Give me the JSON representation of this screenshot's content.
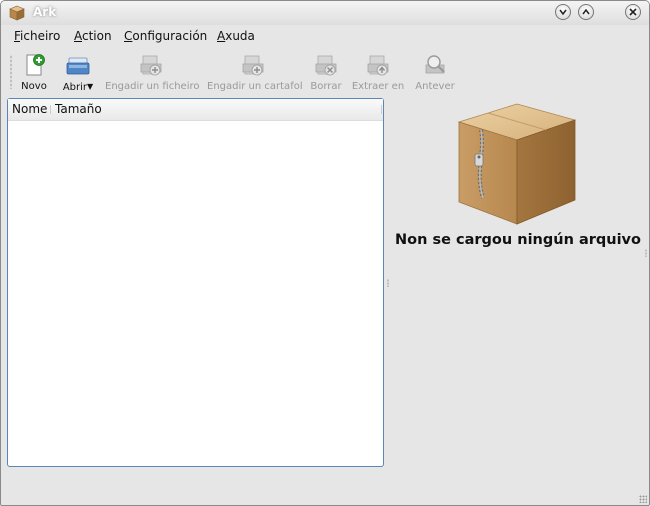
{
  "window": {
    "title": "Ark"
  },
  "menu": [
    "Ficheiro",
    "Action",
    "Configuración",
    "Axuda"
  ],
  "toolbar": {
    "new_label": "Novo",
    "open_label": "Abrir",
    "add_file_label": "Engadir un ficheiro",
    "add_folder_label": "Engadir un cartafol",
    "delete_label": "Borrar",
    "extract_label": "Extraer en",
    "preview_label": "Antever"
  },
  "archive_list": {
    "columns": [
      "Nome",
      "Tamaño"
    ],
    "rows": []
  },
  "info_panel": {
    "message": "Non se cargou ningún arquivo"
  },
  "icons": {
    "app": "ark-package-icon",
    "new": "new-archive-icon",
    "open": "open-archive-icon",
    "add_file": "add-file-icon",
    "add_folder": "add-folder-icon",
    "delete": "delete-icon",
    "extract": "extract-icon",
    "preview": "preview-icon"
  },
  "colors": {
    "panel_border": "#5b86b8",
    "add_green": "#2e9e2e",
    "box_brown": "#c49a63"
  }
}
